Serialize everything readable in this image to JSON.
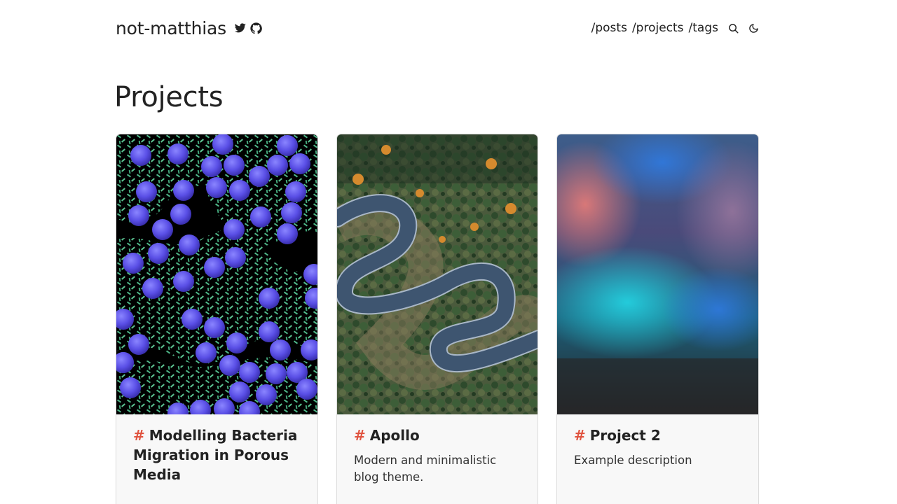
{
  "header": {
    "site_name": "not-matthias",
    "social": [
      {
        "icon": "twitter-icon"
      },
      {
        "icon": "github-icon"
      }
    ],
    "nav": [
      {
        "label": "/posts"
      },
      {
        "label": "/projects"
      },
      {
        "label": "/tags"
      }
    ],
    "actions": [
      {
        "icon": "search-icon"
      },
      {
        "icon": "moon-icon"
      }
    ]
  },
  "main": {
    "title": "Projects",
    "hash_symbol": "#",
    "accent_color": "#e0533f",
    "projects": [
      {
        "title": "Modelling Bacteria Migration in Porous Media",
        "description": "",
        "image": "bacteria-simulation-image"
      },
      {
        "title": "Apollo",
        "description": "Modern and minimalistic blog theme.",
        "image": "winding-road-forest-image"
      },
      {
        "title": "Project 2",
        "description": "Example description",
        "image": "blurred-gradient-image"
      }
    ]
  }
}
